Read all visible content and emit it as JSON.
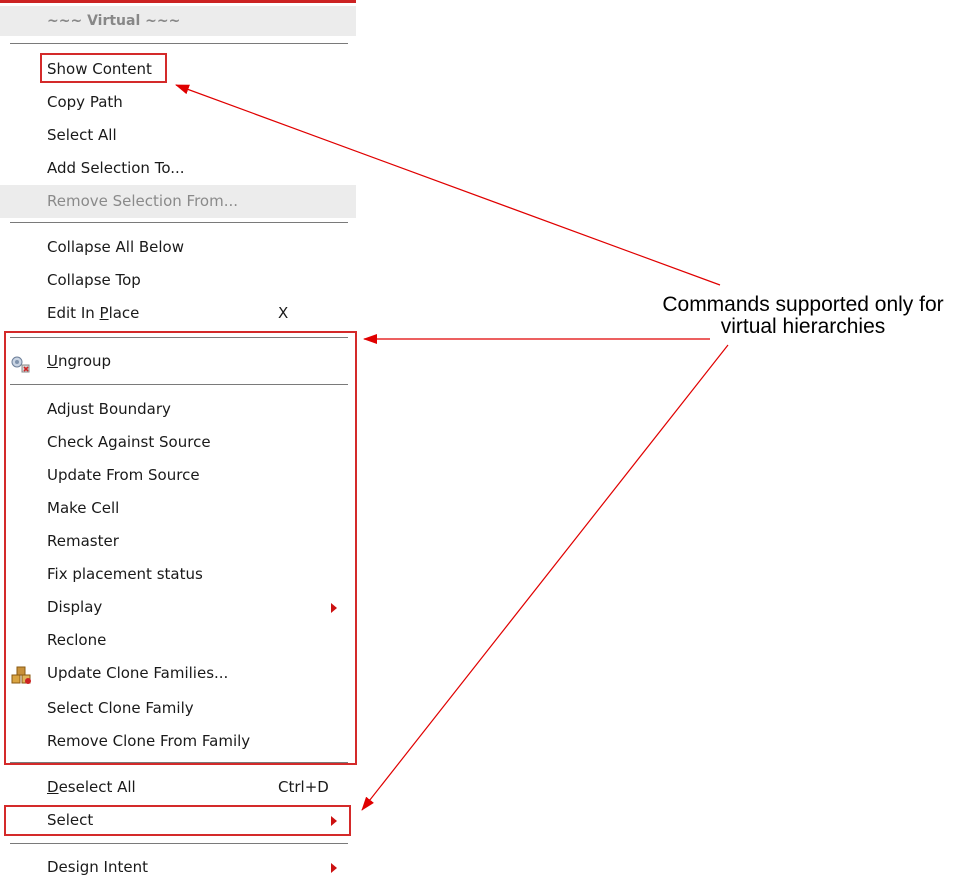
{
  "menu": {
    "header": "~~~ Virtual ~~~",
    "group1": [
      {
        "label": "Show Content"
      },
      {
        "label": "Copy Path"
      },
      {
        "label": "Select All"
      },
      {
        "label": "Add Selection To..."
      },
      {
        "label": "Remove Selection From...",
        "disabled": true
      }
    ],
    "group2": [
      {
        "label": "Collapse All Below"
      },
      {
        "label": "Collapse Top"
      },
      {
        "label_pre": "Edit In ",
        "label_mn": "P",
        "label_post": "lace",
        "shortcut": "X"
      }
    ],
    "ungroup": {
      "label_mn": "U",
      "label_post": "ngroup",
      "icon": "ungroup-icon"
    },
    "group3": [
      {
        "label": "Adjust Boundary"
      },
      {
        "label": "Check Against Source"
      },
      {
        "label": "Update From Source"
      },
      {
        "label": "Make Cell"
      },
      {
        "label": "Remaster"
      },
      {
        "label": "Fix placement status"
      },
      {
        "label": "Display",
        "submenu": true
      },
      {
        "label": "Reclone"
      },
      {
        "label": "Update Clone Families...",
        "icon": "clone-families-icon"
      },
      {
        "label": "Select Clone Family"
      },
      {
        "label": "Remove Clone From Family"
      }
    ],
    "deselect_all": {
      "label_mn": "D",
      "label_post": "eselect All",
      "shortcut": "Ctrl+D"
    },
    "select": {
      "label": "Select"
    },
    "design_intent": {
      "label": "Design Intent"
    }
  },
  "callout": {
    "line1": "Commands supported only for",
    "line2": "virtual hierarchies"
  },
  "colors": {
    "annotation_red": "#d42a2a",
    "menu_disabled_bg": "#ececec"
  }
}
